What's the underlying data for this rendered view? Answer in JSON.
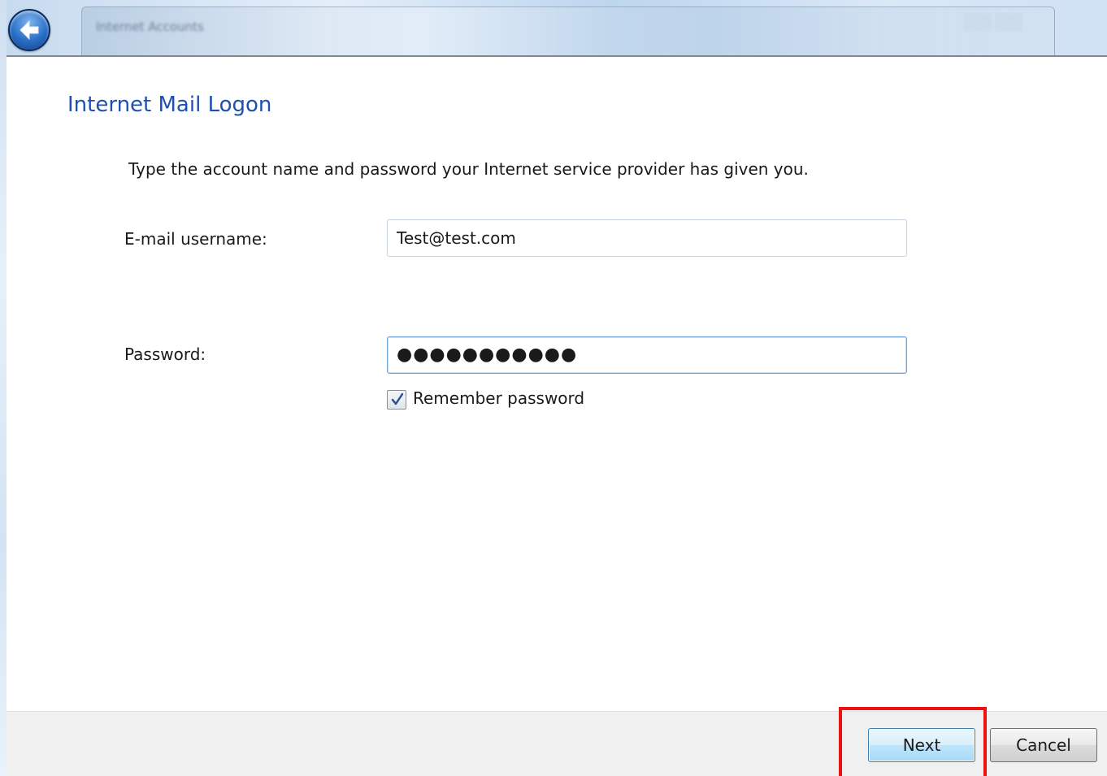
{
  "window": {
    "title": "Internet Accounts",
    "back_icon": "back-arrow-icon"
  },
  "page": {
    "title": "Internet Mail Logon",
    "instructions": "Type the account name and password your Internet service provider has given you."
  },
  "form": {
    "username_label": "E-mail username:",
    "username_value": "Test@test.com",
    "password_label": "Password:",
    "password_display": "●●●●●●●●●●●",
    "remember_label": "Remember password",
    "remember_checked": true
  },
  "footer": {
    "next_label": "Next",
    "cancel_label": "Cancel"
  },
  "colors": {
    "title_blue": "#1e50b3",
    "highlight_red": "#ee1111"
  }
}
